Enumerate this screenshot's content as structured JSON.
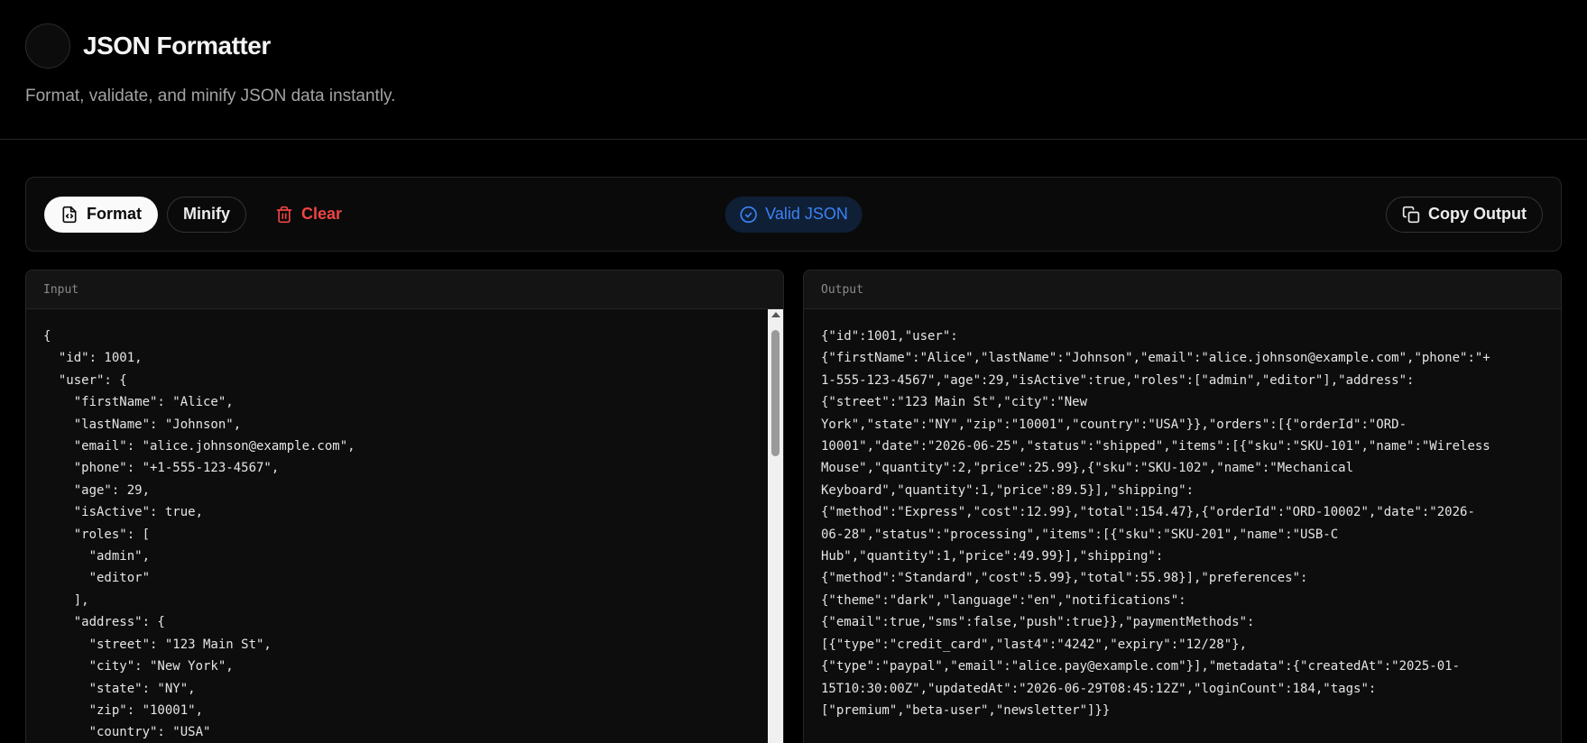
{
  "header": {
    "title": "JSON Formatter",
    "subtitle": "Format, validate, and minify JSON data instantly."
  },
  "toolbar": {
    "format_label": "Format",
    "minify_label": "Minify",
    "clear_label": "Clear",
    "status_label": "Valid JSON",
    "copy_label": "Copy Output"
  },
  "icons": {
    "format": "file-code-icon",
    "clear": "trash-icon",
    "status": "check-circle-icon",
    "copy": "copy-icon"
  },
  "colors": {
    "background": "#000000",
    "clear": "#ef4444",
    "status": "#3b82f6",
    "primary_button": "#fafafa"
  },
  "input": {
    "label": "Input",
    "value": "{\n  \"id\": 1001,\n  \"user\": {\n    \"firstName\": \"Alice\",\n    \"lastName\": \"Johnson\",\n    \"email\": \"alice.johnson@example.com\",\n    \"phone\": \"+1-555-123-4567\",\n    \"age\": 29,\n    \"isActive\": true,\n    \"roles\": [\n      \"admin\",\n      \"editor\"\n    ],\n    \"address\": {\n      \"street\": \"123 Main St\",\n      \"city\": \"New York\",\n      \"state\": \"NY\",\n      \"zip\": \"10001\",\n      \"country\": \"USA\""
  },
  "output": {
    "label": "Output",
    "value": "{\"id\":1001,\"user\":\n{\"firstName\":\"Alice\",\"lastName\":\"Johnson\",\"email\":\"alice.johnson@example.com\",\"phone\":\"+\n1-555-123-4567\",\"age\":29,\"isActive\":true,\"roles\":[\"admin\",\"editor\"],\"address\":\n{\"street\":\"123 Main St\",\"city\":\"New\nYork\",\"state\":\"NY\",\"zip\":\"10001\",\"country\":\"USA\"}},\"orders\":[{\"orderId\":\"ORD-\n10001\",\"date\":\"2026-06-25\",\"status\":\"shipped\",\"items\":[{\"sku\":\"SKU-101\",\"name\":\"Wireless\nMouse\",\"quantity\":2,\"price\":25.99},{\"sku\":\"SKU-102\",\"name\":\"Mechanical\nKeyboard\",\"quantity\":1,\"price\":89.5}],\"shipping\":\n{\"method\":\"Express\",\"cost\":12.99},\"total\":154.47},{\"orderId\":\"ORD-10002\",\"date\":\"2026-\n06-28\",\"status\":\"processing\",\"items\":[{\"sku\":\"SKU-201\",\"name\":\"USB-C\nHub\",\"quantity\":1,\"price\":49.99}],\"shipping\":\n{\"method\":\"Standard\",\"cost\":5.99},\"total\":55.98}],\"preferences\":\n{\"theme\":\"dark\",\"language\":\"en\",\"notifications\":\n{\"email\":true,\"sms\":false,\"push\":true}},\"paymentMethods\":\n[{\"type\":\"credit_card\",\"last4\":\"4242\",\"expiry\":\"12/28\"},\n{\"type\":\"paypal\",\"email\":\"alice.pay@example.com\"}],\"metadata\":{\"createdAt\":\"2025-01-\n15T10:30:00Z\",\"updatedAt\":\"2026-06-29T08:45:12Z\",\"loginCount\":184,\"tags\":\n[\"premium\",\"beta-user\",\"newsletter\"]}}"
  }
}
